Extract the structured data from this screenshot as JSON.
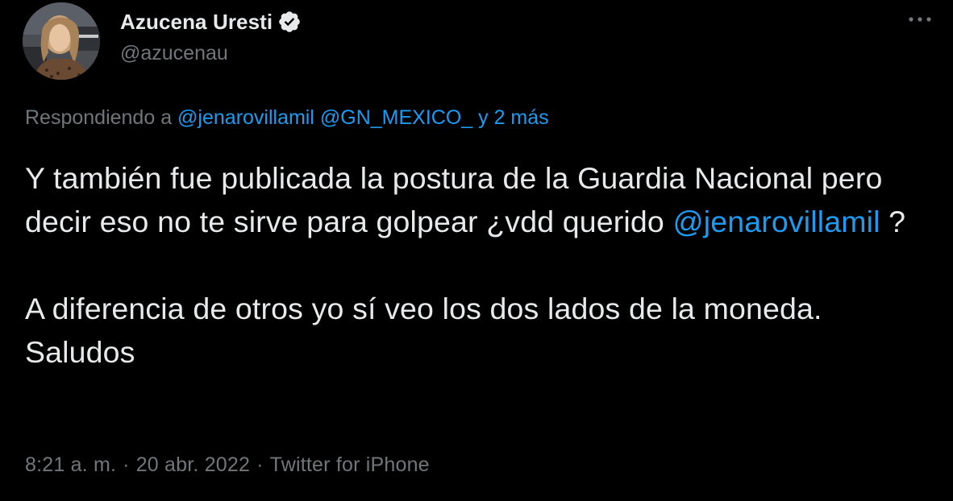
{
  "author": {
    "display_name": "Azucena Uresti",
    "handle": "@azucenau",
    "verified": true,
    "avatar_icon": "profile-photo"
  },
  "more_icon": "more-horizontal-icon",
  "replying": {
    "prefix": "Respondiendo a",
    "mentions": [
      "@jenarovillamil",
      "@GN_MEXICO_"
    ],
    "others": "y 2 más"
  },
  "tweet": {
    "line1": "Y también fue publicada la postura de la Guardia Nacional pero decir eso no te sirve para golpear ¿vdd querido ",
    "mention": "@jenarovillamil",
    "line1_end": " ?",
    "paragraph2": "A diferencia de otros yo sí veo los dos lados de la moneda. Saludos"
  },
  "meta": {
    "time": "8:21 a. m.",
    "separator": "·",
    "date": "20 abr. 2022",
    "source": "Twitter for iPhone"
  },
  "colors": {
    "background": "#000000",
    "text": "#e7e9ea",
    "secondary": "#71767b",
    "link": "#1d9bf0"
  }
}
